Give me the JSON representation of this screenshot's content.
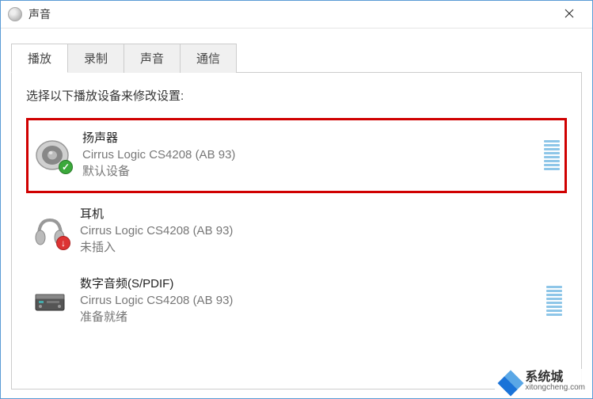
{
  "window": {
    "title": "声音"
  },
  "tabs": [
    {
      "label": "播放",
      "active": true
    },
    {
      "label": "录制",
      "active": false
    },
    {
      "label": "声音",
      "active": false
    },
    {
      "label": "通信",
      "active": false
    }
  ],
  "instruction": "选择以下播放设备来修改设置:",
  "devices": [
    {
      "name": "扬声器",
      "driver": "Cirrus Logic CS4208 (AB 93)",
      "status": "默认设备",
      "icon": "speaker",
      "badge": "check",
      "highlighted": true
    },
    {
      "name": "耳机",
      "driver": "Cirrus Logic CS4208 (AB 93)",
      "status": "未插入",
      "icon": "headphones",
      "badge": "down",
      "highlighted": false
    },
    {
      "name": "数字音频(S/PDIF)",
      "driver": "Cirrus Logic CS4208 (AB 93)",
      "status": "准备就绪",
      "icon": "receiver",
      "badge": "none",
      "highlighted": false
    }
  ],
  "watermark": {
    "cn": "系统城",
    "en": "xitongcheng.com"
  }
}
